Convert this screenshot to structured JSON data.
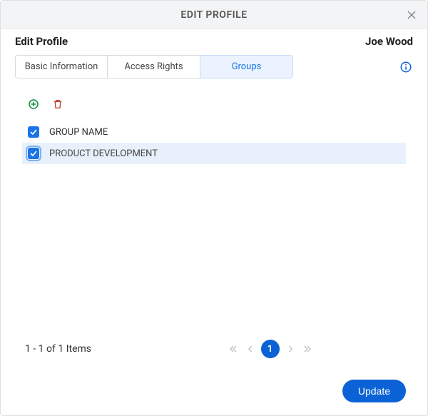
{
  "title": "EDIT PROFILE",
  "subtitle": "Edit Profile",
  "user_name": "Joe Wood",
  "tabs": {
    "basic": "Basic Information",
    "access": "Access Rights",
    "groups": "Groups",
    "active": "groups"
  },
  "table": {
    "header": "GROUP NAME",
    "header_checked": true,
    "rows": [
      {
        "name": "PRODUCT DEVELOPMENT",
        "checked": true
      }
    ]
  },
  "pagination": {
    "label": "1 - 1 of 1 Items",
    "current": "1"
  },
  "buttons": {
    "update": "Update"
  }
}
